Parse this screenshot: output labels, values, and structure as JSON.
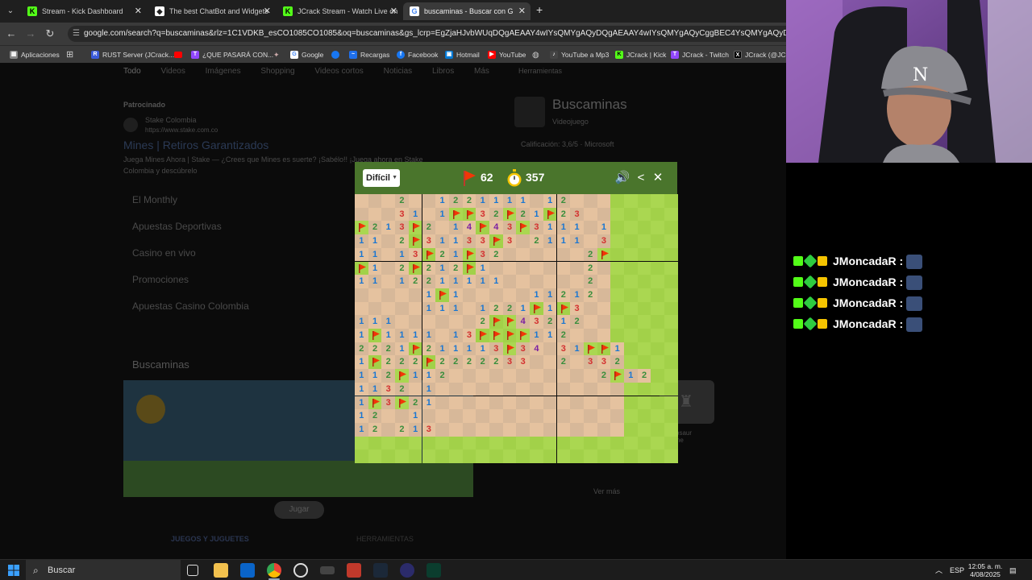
{
  "browser": {
    "tabs": [
      {
        "title": "Stream - Kick Dashboard",
        "active": false,
        "favicon": "kick-icon"
      },
      {
        "title": "The best ChatBot and Widgets",
        "active": false,
        "favicon": "botrix-icon"
      },
      {
        "title": "JCrack Stream - Watch Live on",
        "active": false,
        "favicon": "kick-icon"
      },
      {
        "title": "buscaminas - Buscar con G",
        "active": true,
        "favicon": "google-icon"
      }
    ],
    "new_tab": "+",
    "url": "google.com/search?q=buscaminas&rlz=1C1VDKB_esCO1085CO1085&oq=buscaminas&gs_lcrp=EgZjaHJvbWUqDQgAEAAY4wIYsQMYgAQyDQgAEAAY4wIYsQMYgAQyCggBEC4YsQMYgAQyDQgCEAAYgwEYsQMY",
    "bookmarks": [
      {
        "label": "Aplicaciones",
        "icon": "apps-icon",
        "color": "#888888"
      },
      {
        "label": "RUST Server (JCrack...",
        "icon": "rust-icon",
        "color": "#3b5bdb"
      },
      {
        "label": "¿QUE PASARÁ CON...",
        "icon": "twitch-icon",
        "color": "#9146ff"
      },
      {
        "label": "Google",
        "icon": "google-icon",
        "color": "#4285f4"
      },
      {
        "label": "Recargas",
        "icon": "recargas-icon",
        "color": "#1f6feb"
      },
      {
        "label": "Facebook",
        "icon": "facebook-icon",
        "color": "#1877f2"
      },
      {
        "label": "Hotmail",
        "icon": "hotmail-icon",
        "color": "#0078d4"
      },
      {
        "label": "YouTube",
        "icon": "youtube-icon",
        "color": "#ff0000"
      },
      {
        "label": "YouTube a Mp3",
        "icon": "ytmp3-icon",
        "color": "#444444"
      },
      {
        "label": "JCrack | Kick",
        "icon": "kick-icon",
        "color": "#53fc18"
      },
      {
        "label": "JCrack - Twitch",
        "icon": "twitch-icon",
        "color": "#9146ff"
      },
      {
        "label": "JCrack (@JCra",
        "icon": "x-icon",
        "color": "#000000"
      }
    ]
  },
  "google": {
    "tabs": [
      "Todo",
      "Videos",
      "Imágenes",
      "Shopping",
      "Videos cortos",
      "Noticias",
      "Libros",
      "Más"
    ],
    "sponsored": "Patrocinado",
    "ad_site": "Stake Colombia",
    "ad_url": "https://www.stake.com.co",
    "ad_title": "Mines | Retiros Garantizados",
    "ad_desc1": "Juega Mines Ahora | Stake — ¿Crees que Mines es suerte? ¡Sabélo!! ¡Juega ahora en Stake",
    "ad_desc2": "Colombia y descúbrelo",
    "ad_links": [
      "El Monthly",
      "Apuestas Deportivas",
      "Casino en vivo",
      "Promociones",
      "Apuestas Casino Colombia"
    ],
    "section_title": "Buscaminas",
    "play_button": "Jugar",
    "bottom_tabs": [
      "JUEGOS Y JUGUETES",
      "HERRAMIENTAS"
    ],
    "panel_header": "Herramientas",
    "panel_title": "Buscaminas",
    "panel_subtitle": "Videojuego",
    "panel_rating": "Calificación: 3,6/5 · Microsoft",
    "panel_more": "Ver más",
    "panel_dino": "Dinosaur Game"
  },
  "game": {
    "difficulty": "Difícil",
    "flags": "62",
    "time": "357",
    "colors": {
      "header": "#4a752c",
      "light_grass": "#aad751",
      "dark_grass": "#a2d149",
      "light_dirt": "#e5c29f",
      "dark_dirt": "#d7b899"
    },
    "board_rows": [
      "...2..1221111.12...",
      "...31.1FF32F21F23..",
      "F213F2.14F43F3111.1",
      "11.2F31133F3.2111.3",
      "11.13F21F32......2F",
      "F1.2F212F1.......2.",
      "11.12211111......2.",
      ".....1F1.....11212.",
      ".....111.1221F1F3..",
      "111......2FF43212..",
      "1F1111.13FFFF112...",
      "2221F211113F34.31FF1",
      "1F222F2222233..2.332",
      "112F112...........2F12",
      "1132.1..............",
      "1F3F21..............",
      "12..1...............",
      "12.213.............."
    ]
  },
  "chat": {
    "lines": [
      {
        "user": "JMoncadaR :"
      },
      {
        "user": "JMoncadaR :"
      },
      {
        "user": "JMoncadaR :"
      },
      {
        "user": "JMoncadaR :"
      }
    ]
  },
  "taskbar": {
    "search_placeholder": "Buscar",
    "language": "ESP",
    "time": "12:05 a. m.",
    "date": "4/08/2025"
  }
}
